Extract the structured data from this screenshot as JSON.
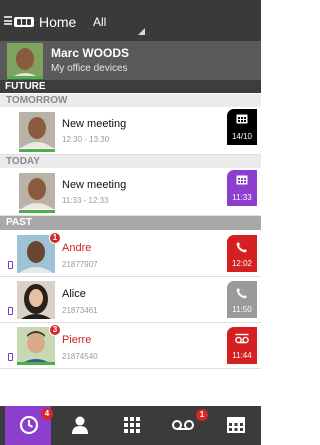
{
  "header": {
    "home_label": "Home",
    "filter_label": "All"
  },
  "profile": {
    "name": "Marc WOODS",
    "subtitle": "My office devices"
  },
  "sections": {
    "future": "FUTURE",
    "tomorrow": "TOMORROW",
    "today": "TODAY",
    "past": "PAST"
  },
  "meetings": [
    {
      "title": "New meeting",
      "time": "12:30 - 13:30",
      "tile_label": "14/10",
      "tile_color": "#000000"
    },
    {
      "title": "New meeting",
      "time": "11:33 - 12:33",
      "tile_label": "11:33",
      "tile_color": "#8c3fcf"
    }
  ],
  "calls": [
    {
      "name": "Andre",
      "number": "21877907",
      "badge": "1",
      "time": "12:02",
      "tile_color": "#d42020",
      "name_color": "#d42020",
      "icon": "phone-icon"
    },
    {
      "name": "Alice",
      "number": "21873461",
      "badge": "",
      "time": "11:50",
      "tile_color": "#9a9a9a",
      "name_color": "#111111",
      "icon": "phone-icon"
    },
    {
      "name": "Pierre",
      "number": "21874540",
      "badge": "3",
      "time": "11:44",
      "tile_color": "#d42020",
      "name_color": "#d42020",
      "icon": "voicemail-icon"
    }
  ],
  "tabbar": {
    "history_badge": "4",
    "voicemail_badge": "1",
    "accent": "#8c3fcf"
  }
}
